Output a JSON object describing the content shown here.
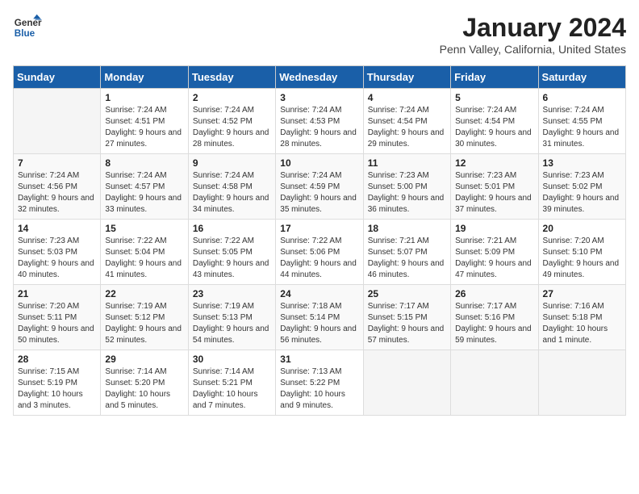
{
  "header": {
    "logo_line1": "General",
    "logo_line2": "Blue",
    "title": "January 2024",
    "location": "Penn Valley, California, United States"
  },
  "weekdays": [
    "Sunday",
    "Monday",
    "Tuesday",
    "Wednesday",
    "Thursday",
    "Friday",
    "Saturday"
  ],
  "weeks": [
    [
      {
        "day": "",
        "empty": true
      },
      {
        "day": "1",
        "sunrise": "7:24 AM",
        "sunset": "4:51 PM",
        "daylight": "9 hours and 27 minutes."
      },
      {
        "day": "2",
        "sunrise": "7:24 AM",
        "sunset": "4:52 PM",
        "daylight": "9 hours and 28 minutes."
      },
      {
        "day": "3",
        "sunrise": "7:24 AM",
        "sunset": "4:53 PM",
        "daylight": "9 hours and 28 minutes."
      },
      {
        "day": "4",
        "sunrise": "7:24 AM",
        "sunset": "4:54 PM",
        "daylight": "9 hours and 29 minutes."
      },
      {
        "day": "5",
        "sunrise": "7:24 AM",
        "sunset": "4:54 PM",
        "daylight": "9 hours and 30 minutes."
      },
      {
        "day": "6",
        "sunrise": "7:24 AM",
        "sunset": "4:55 PM",
        "daylight": "9 hours and 31 minutes."
      }
    ],
    [
      {
        "day": "7",
        "sunrise": "7:24 AM",
        "sunset": "4:56 PM",
        "daylight": "9 hours and 32 minutes."
      },
      {
        "day": "8",
        "sunrise": "7:24 AM",
        "sunset": "4:57 PM",
        "daylight": "9 hours and 33 minutes."
      },
      {
        "day": "9",
        "sunrise": "7:24 AM",
        "sunset": "4:58 PM",
        "daylight": "9 hours and 34 minutes."
      },
      {
        "day": "10",
        "sunrise": "7:24 AM",
        "sunset": "4:59 PM",
        "daylight": "9 hours and 35 minutes."
      },
      {
        "day": "11",
        "sunrise": "7:23 AM",
        "sunset": "5:00 PM",
        "daylight": "9 hours and 36 minutes."
      },
      {
        "day": "12",
        "sunrise": "7:23 AM",
        "sunset": "5:01 PM",
        "daylight": "9 hours and 37 minutes."
      },
      {
        "day": "13",
        "sunrise": "7:23 AM",
        "sunset": "5:02 PM",
        "daylight": "9 hours and 39 minutes."
      }
    ],
    [
      {
        "day": "14",
        "sunrise": "7:23 AM",
        "sunset": "5:03 PM",
        "daylight": "9 hours and 40 minutes."
      },
      {
        "day": "15",
        "sunrise": "7:22 AM",
        "sunset": "5:04 PM",
        "daylight": "9 hours and 41 minutes."
      },
      {
        "day": "16",
        "sunrise": "7:22 AM",
        "sunset": "5:05 PM",
        "daylight": "9 hours and 43 minutes."
      },
      {
        "day": "17",
        "sunrise": "7:22 AM",
        "sunset": "5:06 PM",
        "daylight": "9 hours and 44 minutes."
      },
      {
        "day": "18",
        "sunrise": "7:21 AM",
        "sunset": "5:07 PM",
        "daylight": "9 hours and 46 minutes."
      },
      {
        "day": "19",
        "sunrise": "7:21 AM",
        "sunset": "5:09 PM",
        "daylight": "9 hours and 47 minutes."
      },
      {
        "day": "20",
        "sunrise": "7:20 AM",
        "sunset": "5:10 PM",
        "daylight": "9 hours and 49 minutes."
      }
    ],
    [
      {
        "day": "21",
        "sunrise": "7:20 AM",
        "sunset": "5:11 PM",
        "daylight": "9 hours and 50 minutes."
      },
      {
        "day": "22",
        "sunrise": "7:19 AM",
        "sunset": "5:12 PM",
        "daylight": "9 hours and 52 minutes."
      },
      {
        "day": "23",
        "sunrise": "7:19 AM",
        "sunset": "5:13 PM",
        "daylight": "9 hours and 54 minutes."
      },
      {
        "day": "24",
        "sunrise": "7:18 AM",
        "sunset": "5:14 PM",
        "daylight": "9 hours and 56 minutes."
      },
      {
        "day": "25",
        "sunrise": "7:17 AM",
        "sunset": "5:15 PM",
        "daylight": "9 hours and 57 minutes."
      },
      {
        "day": "26",
        "sunrise": "7:17 AM",
        "sunset": "5:16 PM",
        "daylight": "9 hours and 59 minutes."
      },
      {
        "day": "27",
        "sunrise": "7:16 AM",
        "sunset": "5:18 PM",
        "daylight": "10 hours and 1 minute."
      }
    ],
    [
      {
        "day": "28",
        "sunrise": "7:15 AM",
        "sunset": "5:19 PM",
        "daylight": "10 hours and 3 minutes."
      },
      {
        "day": "29",
        "sunrise": "7:14 AM",
        "sunset": "5:20 PM",
        "daylight": "10 hours and 5 minutes."
      },
      {
        "day": "30",
        "sunrise": "7:14 AM",
        "sunset": "5:21 PM",
        "daylight": "10 hours and 7 minutes."
      },
      {
        "day": "31",
        "sunrise": "7:13 AM",
        "sunset": "5:22 PM",
        "daylight": "10 hours and 9 minutes."
      },
      {
        "day": "",
        "empty": true
      },
      {
        "day": "",
        "empty": true
      },
      {
        "day": "",
        "empty": true
      }
    ]
  ]
}
